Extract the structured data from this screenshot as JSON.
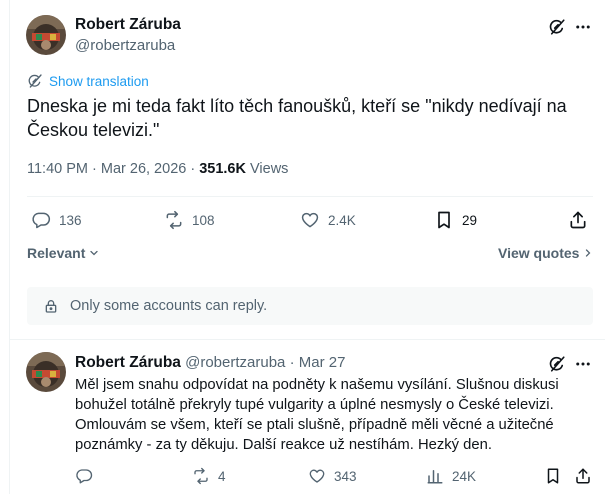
{
  "main_post": {
    "display_name": "Robert Záruba",
    "handle": "@robertzaruba",
    "translate_label": "Show translation",
    "text": "Dneska je mi teda fakt líto těch fanoušků, kteří se \"nikdy nedívají na Českou televizi.\"",
    "time": "11:40 PM · Mar 26, 2026 · ",
    "views_count": "351.6K",
    "views_label": "Views",
    "stats": {
      "replies": "136",
      "reposts": "108",
      "likes": "2.4K",
      "bookmarks": "29"
    }
  },
  "sort": {
    "label": "Relevant",
    "quotes_label": "View quotes"
  },
  "reply_notice": "Only some accounts can reply.",
  "reply_post": {
    "display_name": "Robert Záruba",
    "handle": "@robertzaruba",
    "date": "· Mar 27",
    "text": "Měl jsem snahu odpovídat na podněty k našemu vysílání. Slušnou diskusi bohužel totálně překryly tupé vulgarity a úplné nesmysly o České televizi. Omlouvám se všem, kteří se ptali slušně, případně měli věcné a užitečné poznámky - za ty děkuju. Další reakce už nestíhám. Hezký den.",
    "stats": {
      "replies": "",
      "reposts": "4",
      "likes": "343",
      "views": "24K"
    }
  },
  "colors": {
    "accent": "#1d9bf0",
    "text": "#0f1419",
    "muted": "#536471",
    "border": "#eff3f4",
    "notice_bg": "#f7f9f9"
  }
}
